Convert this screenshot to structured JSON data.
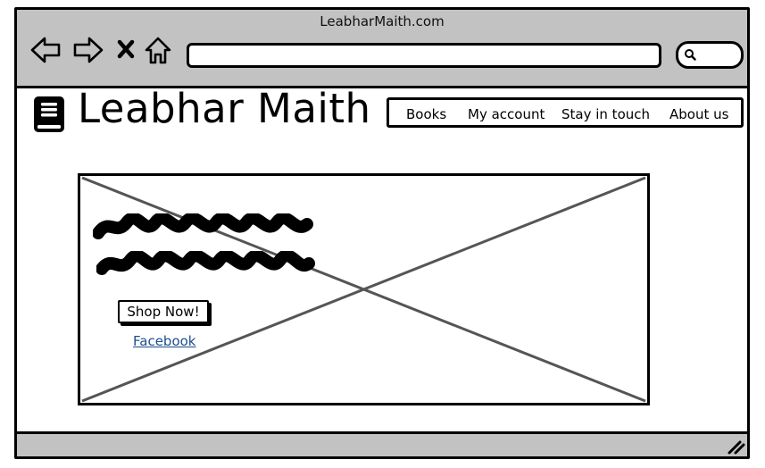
{
  "window": {
    "title": "LeabharMaith.com",
    "address_bar_value": ""
  },
  "toolbar": {
    "icons": [
      "back-arrow-icon",
      "forward-arrow-icon",
      "stop-x-icon",
      "home-icon",
      "search-icon"
    ]
  },
  "site": {
    "brand_name": "Leabhar Maith",
    "logo_icon": "book-icon",
    "nav_items": [
      {
        "label": "Books"
      },
      {
        "label": "My account"
      },
      {
        "label": "Stay in touch"
      },
      {
        "label": "About us"
      }
    ]
  },
  "hero": {
    "image_placeholder": "image-placeholder",
    "scribble_lines": 2,
    "cta_label": "Shop Now!",
    "link_label": "Facebook"
  },
  "colors": {
    "chrome": "#c2c2c2",
    "ink": "#000000",
    "link": "#1d4f8f",
    "placeholder_cross": "#555555"
  }
}
